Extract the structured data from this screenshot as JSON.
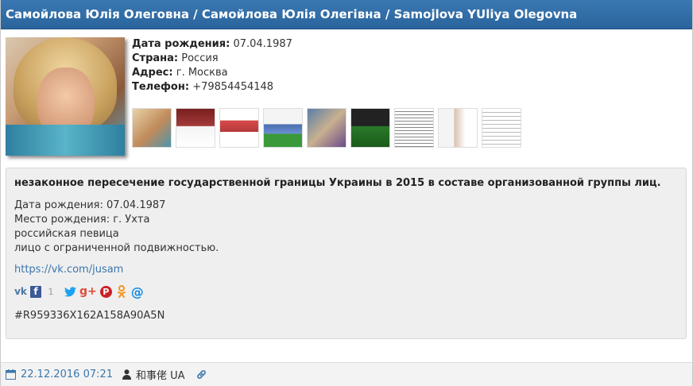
{
  "header": {
    "title": "Самойлова Юлія Олеговна / Самойлова Юлія Олегівна / Samojlova YUliya Olegovna"
  },
  "profile": {
    "birth_label": "Дата рождения:",
    "birth_value": "07.04.1987",
    "country_label": "Страна:",
    "country_value": "Россия",
    "address_label": "Адрес:",
    "address_value": "г. Москва",
    "phone_label": "Телефон:",
    "phone_value": "+79854454148"
  },
  "thumbnails_count": 9,
  "entry": {
    "headline": "незаконное пересечение государственной границы Украины в 2015 в составе организованной группы лиц.",
    "details": [
      "Дата рождения: 07.04.1987",
      "Место рождения: г. Ухта",
      "российская певица",
      "лицо с ограниченной подвижностью."
    ],
    "link": "https://vk.com/jusam",
    "share": {
      "vk": "vk-icon",
      "facebook": "facebook-icon",
      "facebook_count": "1",
      "twitter": "twitter-icon",
      "googleplus": "google-plus-icon",
      "pinterest": "pinterest-icon",
      "odnoklassniki": "odnoklassniki-icon",
      "mail": "email-icon"
    },
    "hash": "#R959336X162A158A90A5N"
  },
  "footer": {
    "date": "22.12.2016 07:21",
    "author": "和事佬 UA"
  },
  "colors": {
    "header_bg": "#2f6ca6",
    "link": "#3b76ad",
    "box_bg": "#efefef"
  }
}
